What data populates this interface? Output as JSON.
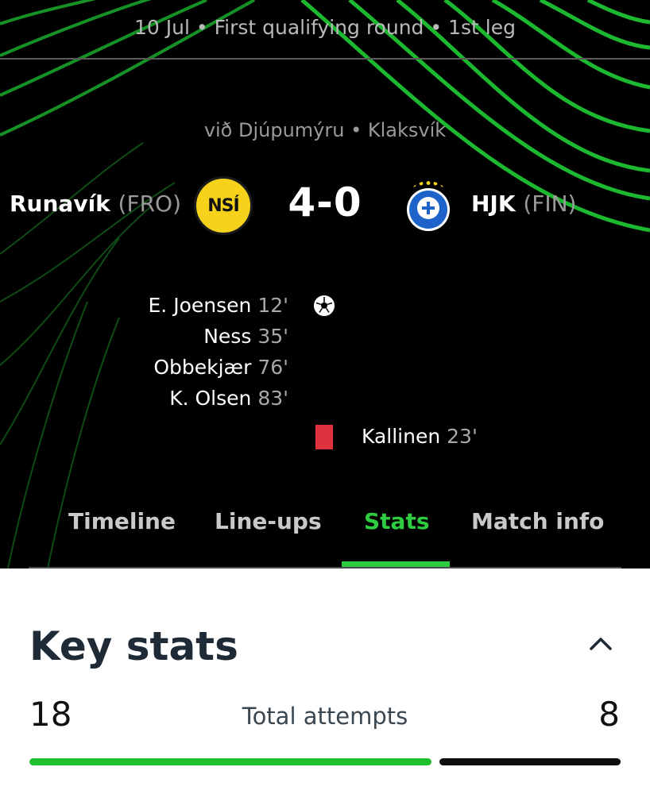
{
  "header": {
    "date_line": "10 Jul • First qualifying round • 1st leg",
    "venue": "við Djúpumýru • Klaksvík"
  },
  "match": {
    "home": {
      "name": "Runavík",
      "country": "(FRO)",
      "crest_text": "NSÍ",
      "crest_color": "#f6d21a"
    },
    "away": {
      "name": "HJK",
      "country": "(FIN)",
      "crest_color": "#1e63c9"
    },
    "score": "4-0",
    "home_goals": [
      {
        "player": "E. Joensen",
        "minute": "12'"
      },
      {
        "player": "Ness",
        "minute": "35'"
      },
      {
        "player": "Obbekjær",
        "minute": "76'"
      },
      {
        "player": "K. Olsen",
        "minute": "83'"
      }
    ],
    "away_red_cards": [
      {
        "player": "Kallinen",
        "minute": "23'"
      }
    ]
  },
  "tabs": [
    {
      "label": "Timeline",
      "active": false
    },
    {
      "label": "Line-ups",
      "active": false
    },
    {
      "label": "Stats",
      "active": true
    },
    {
      "label": "Match info",
      "active": false
    }
  ],
  "key_stats": {
    "title": "Key stats",
    "stat": {
      "label": "Total attempts",
      "home": "18",
      "away": "8",
      "home_share": 0.69
    }
  },
  "colors": {
    "accent_green": "#2ecc40",
    "red_card": "#e0323e",
    "background_dark": "#000000"
  },
  "icons": {
    "goal": "football-icon",
    "collapse": "chevron-up-icon",
    "card": "red-card-icon"
  }
}
